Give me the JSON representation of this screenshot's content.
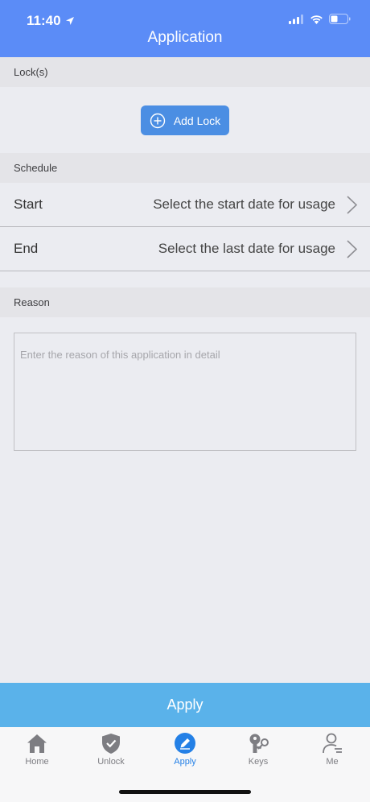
{
  "status_bar": {
    "time": "11:40"
  },
  "header": {
    "title": "Application"
  },
  "locks_section": {
    "title": "Lock(s)",
    "add_button_label": "Add Lock"
  },
  "schedule_section": {
    "title": "Schedule",
    "start": {
      "label": "Start",
      "value": "Select the start date for usage"
    },
    "end": {
      "label": "End",
      "value": "Select the last date for usage"
    }
  },
  "reason_section": {
    "title": "Reason",
    "placeholder": "Enter the reason of this application in detail",
    "value": ""
  },
  "apply_button": {
    "label": "Apply"
  },
  "tabs": [
    {
      "label": "Home",
      "icon": "home-icon"
    },
    {
      "label": "Unlock",
      "icon": "shield-check-icon"
    },
    {
      "label": "Apply",
      "icon": "pencil-circle-icon",
      "active": true
    },
    {
      "label": "Keys",
      "icon": "keys-icon"
    },
    {
      "label": "Me",
      "icon": "person-icon"
    }
  ],
  "colors": {
    "header": "#5b8cf7",
    "add_button": "#4b8ee3",
    "apply_bar": "#5ab2ea",
    "active_tab": "#2480e6",
    "inactive_tab": "#7d7d82"
  }
}
